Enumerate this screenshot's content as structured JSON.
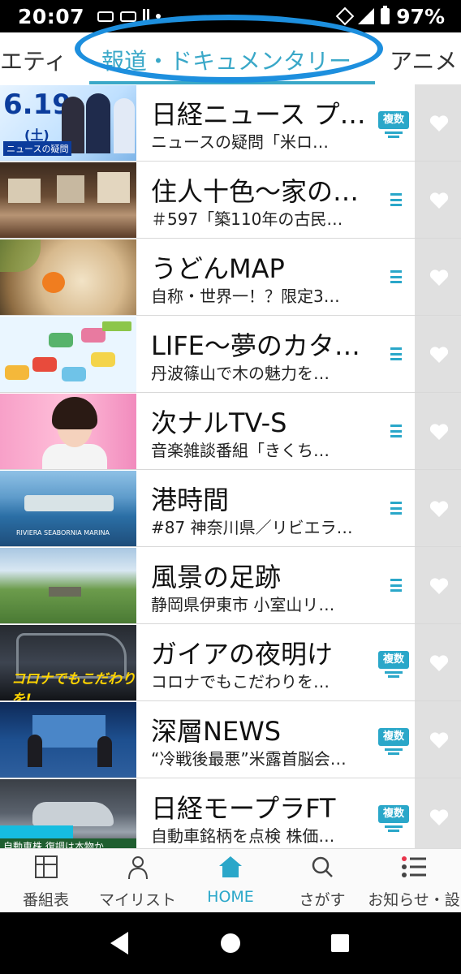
{
  "status_bar": {
    "time": "20:07",
    "battery": "97%"
  },
  "tabs": {
    "left": "エティ",
    "active": "報道・ドキュメンタリー",
    "right": "アニメ"
  },
  "programs": [
    {
      "title": "日経ニュース プ…",
      "subtitle": "ニュースの疑問「米ロ…",
      "badge": "複数",
      "thumb_text": "6.19",
      "thumb_dow": "(土)",
      "thumb_label": "ニュースの疑問"
    },
    {
      "title": "住人十色〜家の…",
      "subtitle": "＃597「築110年の古民…",
      "badge": ""
    },
    {
      "title": "うどんMAP",
      "subtitle": "自称・世界一！？限定3…",
      "badge": ""
    },
    {
      "title": "LIFE〜夢のカタ…",
      "subtitle": "丹波篠山で木の魅力を…",
      "badge": ""
    },
    {
      "title": "次ナルTV-S",
      "subtitle": "音楽雑談番組「きくち…",
      "badge": ""
    },
    {
      "title": "港時間",
      "subtitle": "#87 神奈川県／リビエラ…",
      "badge": "",
      "thumb_text": "RIVIERA SEABORNIA MARINA"
    },
    {
      "title": "風景の足跡",
      "subtitle": "静岡県伊東市 小室山リ…",
      "badge": ""
    },
    {
      "title": "ガイアの夜明け",
      "subtitle": "コロナでもこだわりを…",
      "badge": "複数",
      "thumb_text": "コロナでもこだわりを!"
    },
    {
      "title": "深層NEWS",
      "subtitle": "“冷戦後最悪”米露首脳会…",
      "badge": "複数"
    },
    {
      "title": "日経モープラFT",
      "subtitle": "自動車銘柄を点検 株価…",
      "badge": "複数",
      "thumb_text": "自動車株 復調は本物か"
    }
  ],
  "bottom_nav": [
    {
      "label": "番組表",
      "icon": "grid-icon"
    },
    {
      "label": "マイリスト",
      "icon": "person-icon"
    },
    {
      "label": "HOME",
      "icon": "home-icon",
      "active": true
    },
    {
      "label": "さがす",
      "icon": "search-icon"
    },
    {
      "label": "お知らせ・設",
      "icon": "list-icon"
    }
  ],
  "colors": {
    "accent": "#2aa7c9",
    "highlight_ring": "#1d8fde"
  }
}
